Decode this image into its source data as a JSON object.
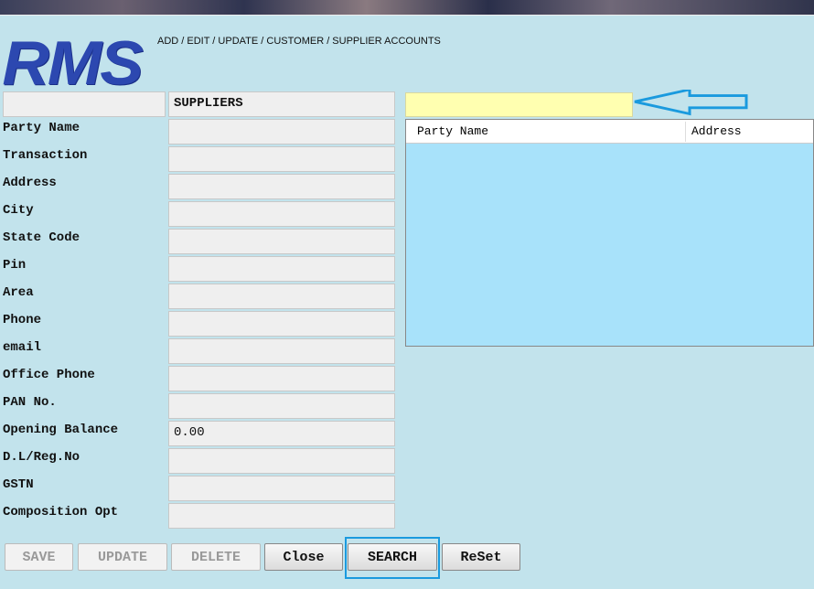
{
  "header": {
    "logo": "RMS",
    "subtitle": "ADD / EDIT / UPDATE / CUSTOMER / SUPPLIER ACCOUNTS"
  },
  "form": {
    "type_value": "SUPPLIERS",
    "fields": [
      {
        "label": "Party Name",
        "value": ""
      },
      {
        "label": "Transaction",
        "value": ""
      },
      {
        "label": "Address",
        "value": ""
      },
      {
        "label": "City",
        "value": ""
      },
      {
        "label": "State Code",
        "value": ""
      },
      {
        "label": "Pin",
        "value": ""
      },
      {
        "label": "Area",
        "value": ""
      },
      {
        "label": "Phone",
        "value": ""
      },
      {
        "label": "email",
        "value": ""
      },
      {
        "label": "Office Phone",
        "value": ""
      },
      {
        "label": "PAN No.",
        "value": ""
      },
      {
        "label": "Opening Balance",
        "value": "0.00"
      },
      {
        "label": "D.L/Reg.No",
        "value": ""
      },
      {
        "label": "GSTN",
        "value": ""
      },
      {
        "label": "Composition Opt",
        "value": ""
      }
    ]
  },
  "search": {
    "value": "",
    "arrow_color": "#1a9ade"
  },
  "grid": {
    "columns": [
      "Party Name",
      "Address"
    ]
  },
  "buttons": {
    "save": "SAVE",
    "update": "UPDATE",
    "delete": "DELETE",
    "close": "Close",
    "search": "SEARCH",
    "reset": "ReSet"
  }
}
